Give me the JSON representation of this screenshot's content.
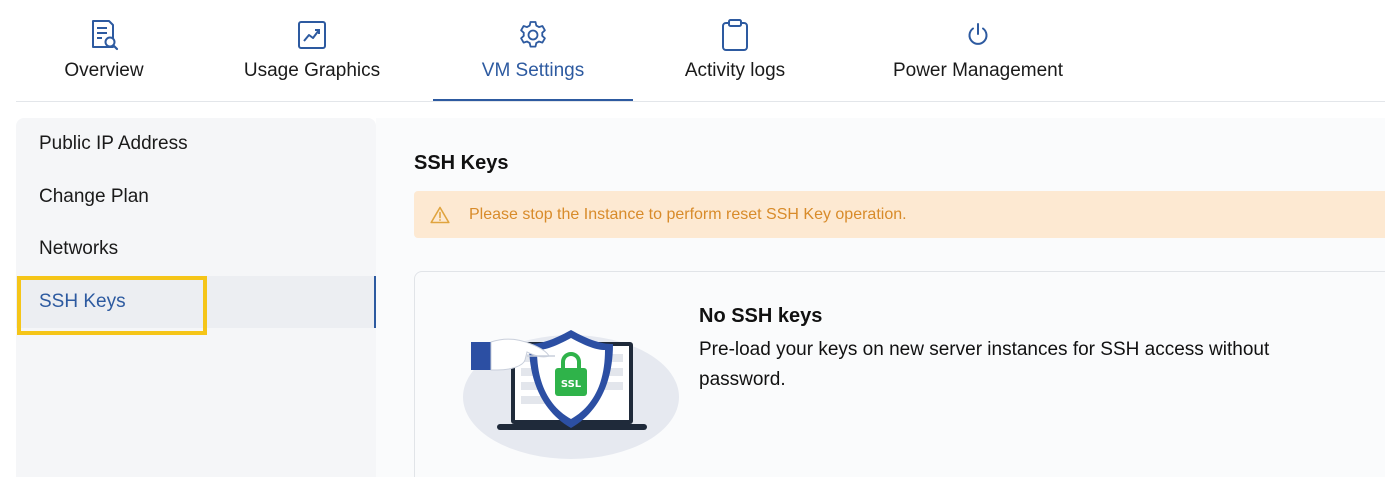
{
  "tabs": [
    {
      "label": "Overview",
      "icon": "document-search-icon",
      "active": false
    },
    {
      "label": "Usage Graphics",
      "icon": "chart-trend-icon",
      "active": false
    },
    {
      "label": "VM Settings",
      "icon": "gear-icon",
      "active": true
    },
    {
      "label": "Activity logs",
      "icon": "clipboard-icon",
      "active": false
    },
    {
      "label": "Power Management",
      "icon": "power-icon",
      "active": false
    }
  ],
  "sidebar": {
    "items": [
      {
        "label": "Public IP Address",
        "active": false
      },
      {
        "label": "Change Plan",
        "active": false
      },
      {
        "label": "Networks",
        "active": false
      },
      {
        "label": "SSH Keys",
        "active": true
      }
    ]
  },
  "main": {
    "title": "SSH Keys",
    "warning": "Please stop the Instance to perform reset SSH Key operation.",
    "empty_state": {
      "title": "No SSH keys",
      "description": "Pre-load your keys on new server instances for SSH access without password.",
      "badge_text": "SSL"
    }
  },
  "colors": {
    "accent": "#2d5aa0",
    "warning_bg": "#fde9d2",
    "warning_text": "#d88b2a",
    "highlight": "#f5c518",
    "ssl_green": "#2fb34a"
  }
}
